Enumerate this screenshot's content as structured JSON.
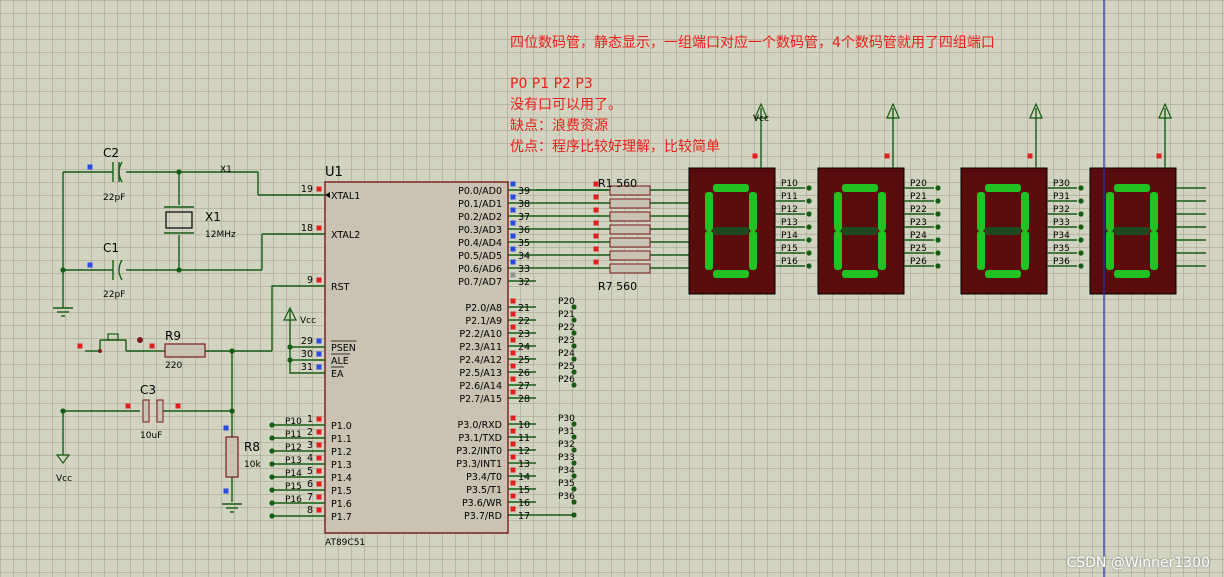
{
  "notes": {
    "line1": "四位数码管，静态显示，一组端口对应一个数码管，4个数码管就用了四组端口",
    "line2": "P0  P1  P2  P3",
    "line3": "没有口可以用了。",
    "line4": "缺点：浪费资源",
    "line5": "优点：程序比较好理解，比较简单"
  },
  "mcu": {
    "ref": "U1",
    "part": "AT89C51",
    "left_pins": [
      {
        "num": "19",
        "name": "XTAL1"
      },
      {
        "num": "18",
        "name": "XTAL2"
      },
      {
        "num": "9",
        "name": "RST"
      },
      {
        "num": "29",
        "name": "PSEN"
      },
      {
        "num": "30",
        "name": "ALE"
      },
      {
        "num": "31",
        "name": "EA"
      },
      {
        "num": "1",
        "name": "P1.0"
      },
      {
        "num": "2",
        "name": "P1.1"
      },
      {
        "num": "3",
        "name": "P1.2"
      },
      {
        "num": "4",
        "name": "P1.3"
      },
      {
        "num": "5",
        "name": "P1.4"
      },
      {
        "num": "6",
        "name": "P1.5"
      },
      {
        "num": "7",
        "name": "P1.6"
      },
      {
        "num": "8",
        "name": "P1.7"
      }
    ],
    "right_pins": [
      {
        "num": "39",
        "name": "P0.0/AD0"
      },
      {
        "num": "38",
        "name": "P0.1/AD1"
      },
      {
        "num": "37",
        "name": "P0.2/AD2"
      },
      {
        "num": "36",
        "name": "P0.3/AD3"
      },
      {
        "num": "35",
        "name": "P0.4/AD4"
      },
      {
        "num": "34",
        "name": "P0.5/AD5"
      },
      {
        "num": "33",
        "name": "P0.6/AD6"
      },
      {
        "num": "32",
        "name": "P0.7/AD7"
      },
      {
        "num": "21",
        "name": "P2.0/A8"
      },
      {
        "num": "22",
        "name": "P2.1/A9"
      },
      {
        "num": "23",
        "name": "P2.2/A10"
      },
      {
        "num": "24",
        "name": "P2.3/A11"
      },
      {
        "num": "25",
        "name": "P2.4/A12"
      },
      {
        "num": "26",
        "name": "P2.5/A13"
      },
      {
        "num": "27",
        "name": "P2.6/A14"
      },
      {
        "num": "28",
        "name": "P2.7/A15"
      },
      {
        "num": "10",
        "name": "P3.0/RXD"
      },
      {
        "num": "11",
        "name": "P3.1/TXD"
      },
      {
        "num": "12",
        "name": "P3.2/INT0"
      },
      {
        "num": "13",
        "name": "P3.3/INT1"
      },
      {
        "num": "14",
        "name": "P3.4/T0"
      },
      {
        "num": "15",
        "name": "P3.5/T1"
      },
      {
        "num": "16",
        "name": "P3.6/WR"
      },
      {
        "num": "17",
        "name": "P3.7/RD"
      }
    ]
  },
  "p1_net_labels": [
    "P10",
    "P11",
    "P12",
    "P13",
    "P14",
    "P15",
    "P16"
  ],
  "p2_net_labels": [
    "P20",
    "P21",
    "P22",
    "P23",
    "P24",
    "P25",
    "P26"
  ],
  "p3_net_labels": [
    "P30",
    "P31",
    "P32",
    "P33",
    "P34",
    "P35",
    "P36"
  ],
  "components": {
    "c2": {
      "ref": "C2",
      "value": "22pF"
    },
    "c1": {
      "ref": "C1",
      "value": "22pF"
    },
    "x1": {
      "ref": "X1",
      "value": "12MHz",
      "net": "X1"
    },
    "r9": {
      "ref": "R9",
      "value": "220"
    },
    "c3": {
      "ref": "C3",
      "value": "10uF"
    },
    "r8": {
      "ref": "R8",
      "value": "10k"
    },
    "rp_top": {
      "ref": "R1",
      "value": "560"
    },
    "rp_bottom": {
      "ref": "R7",
      "value": "560"
    }
  },
  "power": {
    "vcc_ea": "Vcc",
    "vcc_reset": "Vcc",
    "vcc_display": "Vcc"
  },
  "displays": [
    {
      "digit": "0",
      "pin_labels": [
        "P10",
        "P11",
        "P12",
        "P13",
        "P14",
        "P15",
        "P16"
      ]
    },
    {
      "digit": "0",
      "pin_labels": [
        "P20",
        "P21",
        "P22",
        "P23",
        "P24",
        "P25",
        "P26"
      ]
    },
    {
      "digit": "0",
      "pin_labels": [
        "P30",
        "P31",
        "P32",
        "P33",
        "P34",
        "P35",
        "P36"
      ]
    },
    {
      "digit": "0",
      "pin_labels": []
    }
  ],
  "segment_colors": {
    "on": "#22c222",
    "off": "#1c4a1c",
    "body": "#5a0c0c"
  },
  "watermark": "CSDN @Winner1300"
}
